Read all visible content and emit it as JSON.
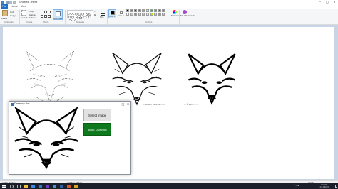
{
  "window": {
    "title": "Untitled - Paint",
    "controls": [
      "–",
      "□",
      "×"
    ]
  },
  "ribbon_tabs": [
    "File",
    "Home",
    "View"
  ],
  "ribbon": {
    "groups": [
      "Clipboard",
      "Image",
      "Tools",
      "Shapes",
      "Colors"
    ],
    "paste_label": "Paste",
    "clipboard_items": [
      "Cut",
      "Copy"
    ],
    "image_items": [
      "Select",
      "Crop",
      "Resize",
      "Rotate"
    ],
    "brushes_label": "Brushes",
    "size_label": "Size",
    "color1_label": "Color 1",
    "color2_label": "Color 2",
    "edit_colors_label": "Edit colors",
    "edit_3d_label": "Edit with Paint 3D",
    "palette_row1": [
      "#000000",
      "#7f7f7f",
      "#880015",
      "#ed1c24",
      "#ff7f27",
      "#fff200",
      "#22b14c",
      "#00a2e8",
      "#3f48cc",
      "#a349a4"
    ],
    "palette_row2": [
      "#ffffff",
      "#c3c3c3",
      "#b97a57",
      "#ffaec9",
      "#ffc90e",
      "#efe4b0",
      "#b5e61d",
      "#99d9ea",
      "#7092be",
      "#c8bfe7"
    ],
    "selected_color": "#000000"
  },
  "canvas": {
    "captions": {
      "wolf2": "— 1000 × 1000 px — —",
      "wolf3": "— © 2019 — —"
    }
  },
  "statusbar": {
    "position": "1082, 456px",
    "selection": "",
    "size": "1798 × 856px",
    "zoom": "100%"
  },
  "drawing_bot": {
    "title": "Drawing Bot",
    "select_button": "Select Image",
    "start_button": "Start Drawing",
    "preview_caption": "— — —",
    "accent_green": "#0f7a1d"
  },
  "taskbar": {
    "clock_time": "12:41",
    "clock_date": "11/11/2019"
  }
}
